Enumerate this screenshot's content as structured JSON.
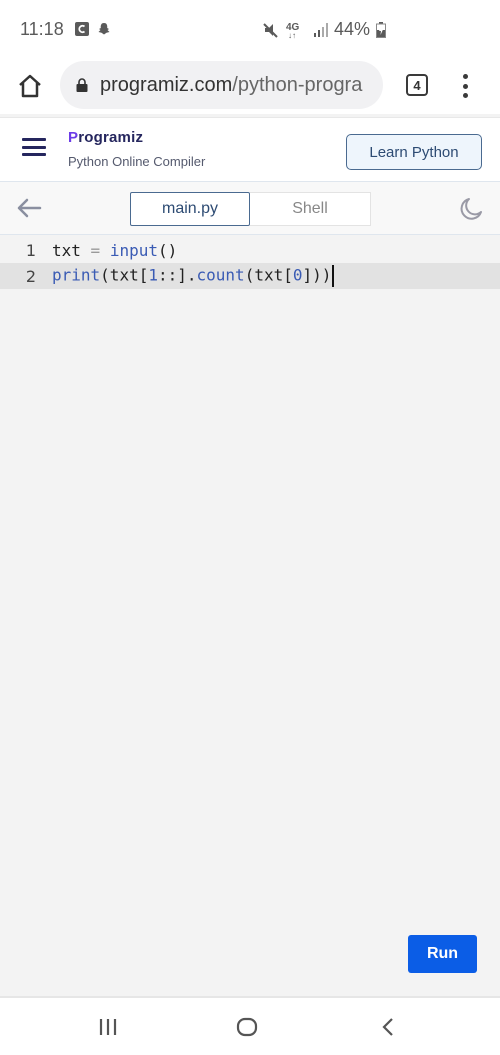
{
  "status_bar": {
    "time": "11:18",
    "battery": "44%",
    "left_icons": [
      "notification-app-icon",
      "snapchat-icon"
    ],
    "right_icons": [
      "mute-icon",
      "4g-lte-icon",
      "signal-icon",
      "battery-icon"
    ]
  },
  "browser": {
    "url_domain": "programiz.com",
    "url_path": "/python-progra",
    "tab_count": "4"
  },
  "site_header": {
    "logo": "rogramiz",
    "logo_initial": "P",
    "subtitle": "Python Online Compiler",
    "learn_button": "Learn Python"
  },
  "editor_toolbar": {
    "tabs": [
      {
        "label": "main.py",
        "active": true
      },
      {
        "label": "Shell",
        "active": false
      }
    ]
  },
  "editor": {
    "lines": [
      {
        "number": "1",
        "tokens": [
          [
            "plain",
            "txt "
          ],
          [
            "op",
            "="
          ],
          [
            "plain",
            " "
          ],
          [
            "kw",
            "input"
          ],
          [
            "plain",
            "()"
          ]
        ]
      },
      {
        "number": "2",
        "tokens": [
          [
            "kw",
            "print"
          ],
          [
            "plain",
            "(txt["
          ],
          [
            "num",
            "1"
          ],
          [
            "plain",
            "::]."
          ],
          [
            "kw",
            "count"
          ],
          [
            "plain",
            "(txt["
          ],
          [
            "num",
            "0"
          ],
          [
            "plain",
            "]))"
          ]
        ],
        "active": true
      }
    ],
    "run_label": "Run"
  },
  "colors": {
    "accent": "#0b5de6",
    "brand_dark": "#25265e",
    "brand_purple": "#6c3ce8"
  }
}
